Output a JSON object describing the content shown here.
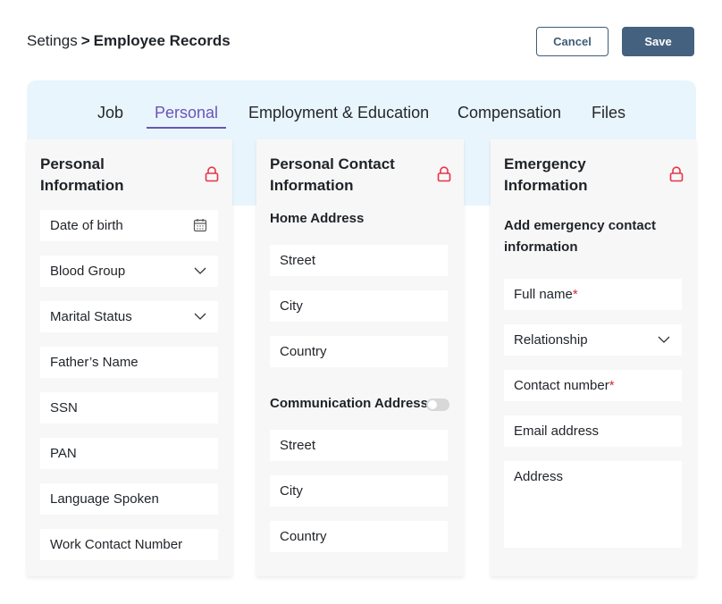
{
  "breadcrumb": {
    "parent": "Setings",
    "separator": ">",
    "current": "Employee Records"
  },
  "actions": {
    "cancel": "Cancel",
    "save": "Save"
  },
  "tabs": [
    {
      "label": "Job"
    },
    {
      "label": "Personal"
    },
    {
      "label": "Employment & Education"
    },
    {
      "label": "Compensation"
    },
    {
      "label": "Files"
    }
  ],
  "active_tab": "Personal",
  "personal_info": {
    "title_line1": "Personal",
    "title_line2": "Information",
    "fields": [
      "Date of birth",
      "Blood Group",
      "Marital Status",
      "Father’s Name",
      "SSN",
      "PAN",
      "Language Spoken",
      "Work Contact Number"
    ]
  },
  "contact_info": {
    "title_line1": "Personal Contact",
    "title_line2": "Information",
    "home_label": "Home Address",
    "home_fields": [
      "Street",
      "City",
      "Country"
    ],
    "comm_label": "Communication Address",
    "comm_toggle_on": false,
    "comm_fields": [
      "Street",
      "City",
      "Country"
    ]
  },
  "emergency_info": {
    "title_line1": "Emergency",
    "title_line2": "Information",
    "note": "Add emergency contact information",
    "fields": [
      "Full name",
      "Relationship",
      "Contact number",
      "Email address",
      "Address"
    ],
    "required_mark": "*"
  },
  "colors": {
    "accent": "#6b55b8",
    "primary_button": "#44627f",
    "lock": "#e8334a",
    "tab_background": "#e9f5fd",
    "required": "#d22e2e"
  },
  "icons": {
    "lock": "lock-icon",
    "calendar": "calendar-icon",
    "dropdown": "chevron-down-icon"
  }
}
